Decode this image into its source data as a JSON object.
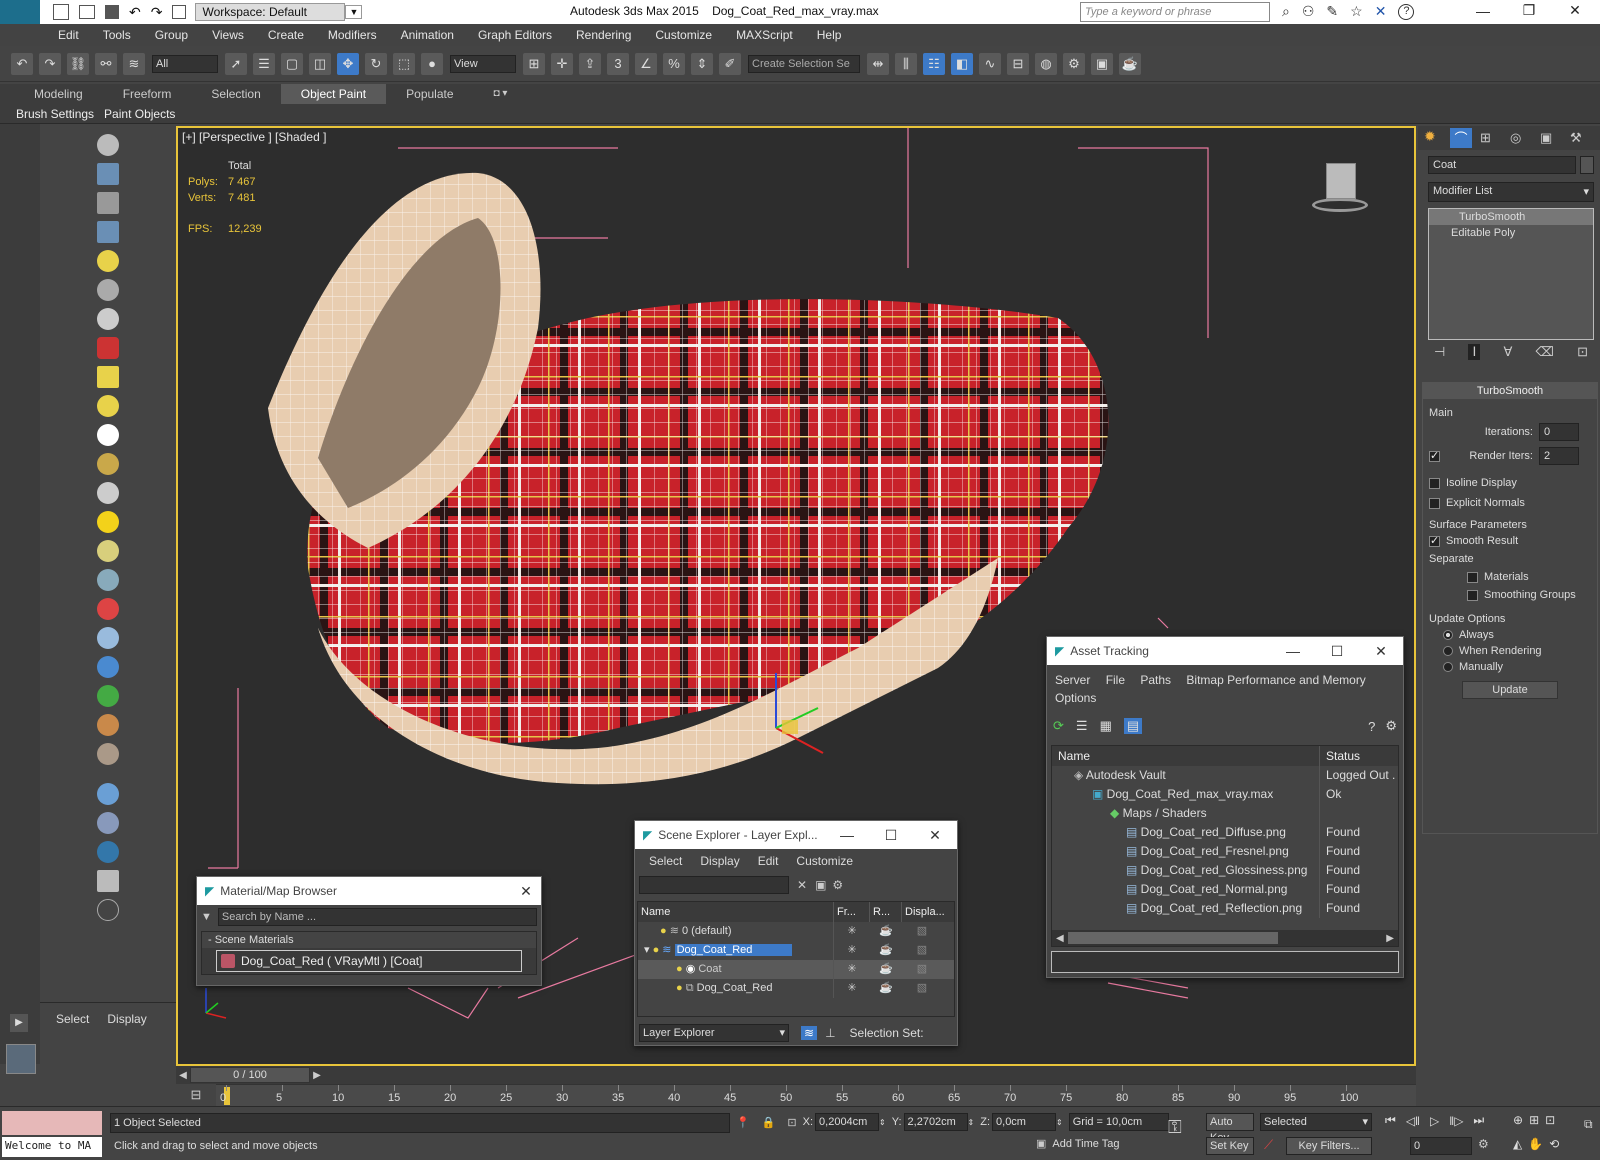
{
  "app": {
    "title": "Autodesk 3ds Max  2015",
    "file": "Dog_Coat_Red_max_vray.max",
    "workspace": "Workspace: Default",
    "search_placeholder": "Type a keyword or phrase",
    "logo": "MAX"
  },
  "menu": [
    "Edit",
    "Tools",
    "Group",
    "Views",
    "Create",
    "Modifiers",
    "Animation",
    "Graph Editors",
    "Rendering",
    "Customize",
    "MAXScript",
    "Help"
  ],
  "toolbar": {
    "filter": "All",
    "view_mode": "View",
    "snap_3": "3",
    "selection_set_placeholder": "Create Selection Se"
  },
  "ribbon": {
    "tabs": [
      "Modeling",
      "Freeform",
      "Selection",
      "Object Paint",
      "Populate"
    ],
    "active": "Object Paint",
    "sub": [
      "Brush Settings",
      "Paint Objects"
    ]
  },
  "viewport": {
    "label": "[+] [Perspective ] [Shaded ]",
    "total_label": "Total",
    "polys_label": "Polys:",
    "polys": "7 467",
    "verts_label": "Verts:",
    "verts": "7 481",
    "fps_label": "FPS:",
    "fps": "12,239"
  },
  "command_panel": {
    "object_name": "Coat",
    "modifier_list": "Modifier List",
    "stack": [
      "TurboSmooth",
      "Editable Poly"
    ],
    "rollout_title": "TurboSmooth",
    "main": "Main",
    "iterations_label": "Iterations:",
    "iterations": "0",
    "render_iters_label": "Render Iters:",
    "render_iters": "2",
    "isoline": "Isoline Display",
    "explicit": "Explicit Normals",
    "surface_params": "Surface Parameters",
    "smooth_result": "Smooth Result",
    "separate": "Separate",
    "materials": "Materials",
    "smoothing_groups": "Smoothing Groups",
    "update_options": "Update Options",
    "always": "Always",
    "when_rendering": "When Rendering",
    "manually": "Manually",
    "update_btn": "Update"
  },
  "asset_tracking": {
    "title": "Asset Tracking",
    "menu": [
      "Server",
      "File",
      "Paths",
      "Bitmap Performance and Memory",
      "Options"
    ],
    "col_name": "Name",
    "col_status": "Status",
    "rows": [
      {
        "name": "Autodesk Vault",
        "status": "Logged Out ."
      },
      {
        "name": "Dog_Coat_Red_max_vray.max",
        "status": "Ok"
      },
      {
        "name": "Maps / Shaders",
        "status": ""
      },
      {
        "name": "Dog_Coat_red_Diffuse.png",
        "status": "Found"
      },
      {
        "name": "Dog_Coat_red_Fresnel.png",
        "status": "Found"
      },
      {
        "name": "Dog_Coat_red_Glossiness.png",
        "status": "Found"
      },
      {
        "name": "Dog_Coat_red_Normal.png",
        "status": "Found"
      },
      {
        "name": "Dog_Coat_red_Reflection.png",
        "status": "Found"
      }
    ]
  },
  "scene_explorer": {
    "title": "Scene Explorer - Layer Expl...",
    "menu": [
      "Select",
      "Display",
      "Edit",
      "Customize"
    ],
    "cols": [
      "Name",
      "Fr...",
      "R...",
      "Displa..."
    ],
    "rows": [
      "0 (default)",
      "Dog_Coat_Red",
      "Coat",
      "Dog_Coat_Red"
    ],
    "footer_mode": "Layer Explorer",
    "selection_set": "Selection Set:"
  },
  "material_browser": {
    "title": "Material/Map Browser",
    "search_placeholder": "Search by Name ...",
    "section": "- Scene Materials",
    "item": "Dog_Coat_Red  ( VRayMtl )  [Coat]"
  },
  "left_panel": {
    "select": "Select",
    "display": "Display"
  },
  "timeline": {
    "frame": "0 / 100",
    "ticks": [
      "0",
      "5",
      "10",
      "15",
      "20",
      "25",
      "30",
      "35",
      "40",
      "45",
      "50",
      "55",
      "60",
      "65",
      "70",
      "75",
      "80",
      "85",
      "90",
      "95",
      "100"
    ]
  },
  "status": {
    "welcome": "Welcome to MA",
    "selected": "1 Object Selected",
    "hint": "Click and drag to select and move objects",
    "x_label": "X:",
    "x": "0,2004cm",
    "y_label": "Y:",
    "y": "2,2702cm",
    "z_label": "Z:",
    "z": "0,0cm",
    "grid": "Grid = 10,0cm",
    "add_time_tag": "Add Time Tag",
    "auto_key": "Auto Key",
    "set_key": "Set Key",
    "key_mode": "Selected",
    "key_filters": "Key Filters...",
    "frame_field": "0"
  },
  "colors": {
    "accent": "#3d7ac8",
    "viewport_border": "#e8c43a",
    "coat_red": "#c8222a"
  }
}
